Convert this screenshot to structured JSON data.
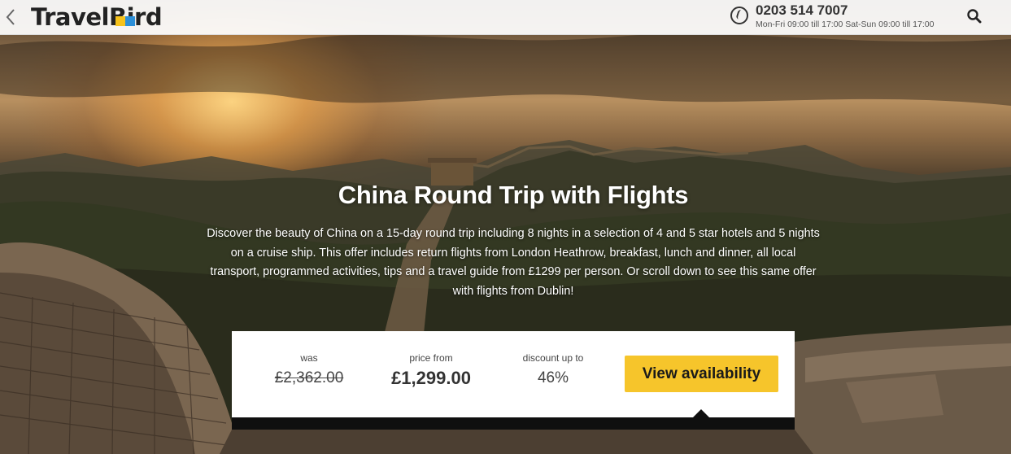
{
  "header": {
    "logo_text": "TravelBird",
    "phone_number": "0203 514 7007",
    "phone_hours": "Mon-Fri 09:00 till 17:00 Sat-Sun 09:00 till 17:00",
    "icons": [
      "back-icon",
      "phone-icon",
      "search-icon"
    ]
  },
  "hero": {
    "title": "China Round Trip with Flights",
    "description": "Discover the beauty of China on a 15-day round trip including 8 nights in a selection of 4 and 5 star hotels and 5 nights on a cruise ship. This offer includes return flights from London Heathrow, breakfast, lunch and dinner, all local transport, programmed activities, tips and a travel guide from £1299 per person. Or scroll down to see this same offer with flights from Dublin!"
  },
  "pricing": {
    "was_label": "was",
    "was_value": "£2,362.00",
    "price_label": "price from",
    "price_value": "£1,299.00",
    "discount_label": "discount up to",
    "discount_value": "46%",
    "cta_label": "View availability"
  },
  "colors": {
    "cta_background": "#f6c52b",
    "logo_yellow": "#f6c21a",
    "logo_blue": "#2c8fd8"
  }
}
